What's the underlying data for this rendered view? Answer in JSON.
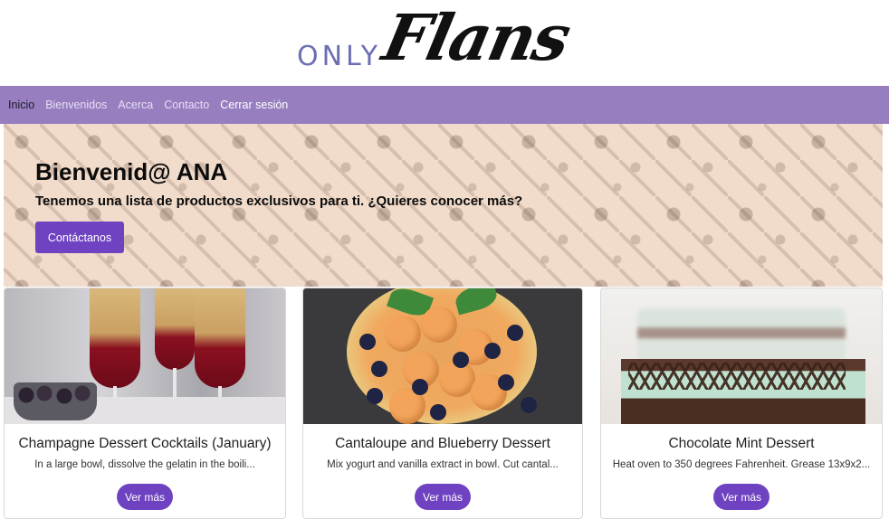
{
  "logo": {
    "only": "ONLY",
    "flans": "Flans"
  },
  "nav": {
    "items": [
      {
        "label": "Inicio"
      },
      {
        "label": "Bienvenidos"
      },
      {
        "label": "Acerca"
      },
      {
        "label": "Contacto"
      },
      {
        "label": "Cerrar sesión"
      }
    ]
  },
  "hero": {
    "title": "Bienvenid@ ANA",
    "subtitle": "Tenemos una lista de productos exclusivos para ti. ¿Quieres conocer más?",
    "button": "Contáctanos"
  },
  "cards": [
    {
      "title": "Champagne Dessert Cocktails (January)",
      "text": "In a large bowl, dissolve the gelatin in the boili...",
      "button": "Ver más"
    },
    {
      "title": "Cantaloupe and Blueberry Dessert",
      "text": "Mix yogurt and vanilla extract in bowl. Cut cantal...",
      "button": "Ver más"
    },
    {
      "title": "Chocolate Mint Dessert",
      "text": "Heat oven to 350 degrees Fahrenheit. Grease 13x9x2...",
      "button": "Ver más"
    }
  ],
  "colors": {
    "navbar": "#977ebf",
    "accent": "#6f42c1",
    "logo_only": "#6c6fb3"
  }
}
